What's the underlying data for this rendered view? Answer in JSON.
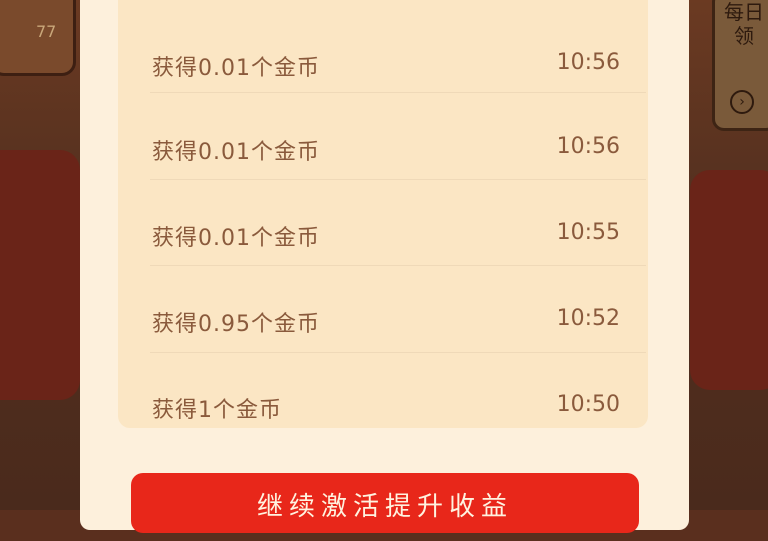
{
  "background": {
    "left_badge_text": "77",
    "right_panel_text": "每日领",
    "right_panel_arrow": "›"
  },
  "records": [
    {
      "label": "获得0.01个金币",
      "time": "10:56"
    },
    {
      "label": "获得0.01个金币",
      "time": "10:56"
    },
    {
      "label": "获得0.01个金币",
      "time": "10:55"
    },
    {
      "label": "获得0.95个金币",
      "time": "10:52"
    },
    {
      "label": "获得1个金币",
      "time": "10:50"
    }
  ],
  "cta": {
    "label": "继续激活提升收益"
  },
  "colors": {
    "accent": "#e8271a",
    "text": "#8a5a3c",
    "card": "#fbe6c4"
  }
}
